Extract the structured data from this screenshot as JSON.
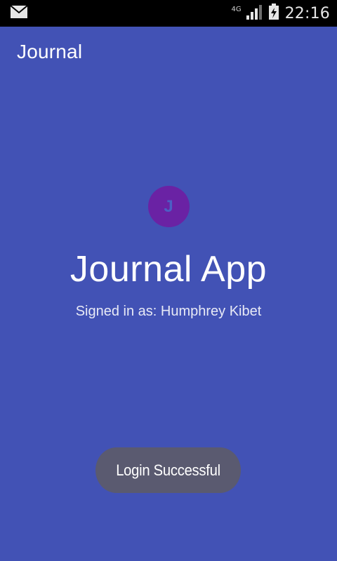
{
  "status_bar": {
    "network_type": "4G",
    "time": "22:16",
    "notification_icon": "mail-icon",
    "signal_icon": "signal-icon",
    "battery_icon": "battery-charging-icon"
  },
  "app_bar": {
    "title": "Journal"
  },
  "main": {
    "avatar_letter": "J",
    "headline": "Journal App",
    "signed_in_text": "Signed in as: Humphrey Kibet"
  },
  "toast": {
    "message": "Login Successful"
  },
  "colors": {
    "background": "#4252b5",
    "status_bar": "#000000",
    "avatar": "#6a22a4",
    "toast": "#5a5a70",
    "text": "#ffffff"
  }
}
